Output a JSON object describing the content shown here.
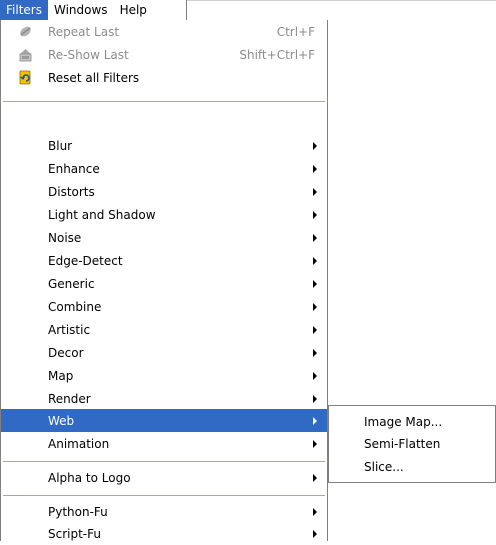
{
  "menubar": [
    {
      "label": "Filters",
      "active": true
    },
    {
      "label": "Windows",
      "active": false
    },
    {
      "label": "Help",
      "active": false
    }
  ],
  "menu": {
    "items": [
      {
        "label": "Repeat Last",
        "shortcut": "Ctrl+F",
        "disabled": true,
        "icon": "repeat-icon"
      },
      {
        "label": "Re-Show Last",
        "shortcut": "Shift+Ctrl+F",
        "disabled": true,
        "icon": "reshow-icon"
      },
      {
        "label": "Reset all Filters",
        "shortcut": "",
        "disabled": false,
        "icon": "reset-icon"
      },
      {
        "label": "Blur",
        "submenu": true
      },
      {
        "label": "Enhance",
        "submenu": true
      },
      {
        "label": "Distorts",
        "submenu": true
      },
      {
        "label": "Light and Shadow",
        "submenu": true
      },
      {
        "label": "Noise",
        "submenu": true
      },
      {
        "label": "Edge-Detect",
        "submenu": true
      },
      {
        "label": "Generic",
        "submenu": true
      },
      {
        "label": "Combine",
        "submenu": true
      },
      {
        "label": "Artistic",
        "submenu": true
      },
      {
        "label": "Decor",
        "submenu": true
      },
      {
        "label": "Map",
        "submenu": true
      },
      {
        "label": "Render",
        "submenu": true
      },
      {
        "label": "Web",
        "submenu": true,
        "selected": true
      },
      {
        "label": "Animation",
        "submenu": true
      },
      {
        "label": "Alpha to Logo",
        "submenu": true
      },
      {
        "label": "Python-Fu",
        "submenu": true
      },
      {
        "label": "Script-Fu",
        "submenu": true
      }
    ]
  },
  "web_submenu": {
    "items": [
      "Image Map...",
      "Semi-Flatten",
      "Slice..."
    ]
  },
  "colors": {
    "highlight": "#316ac5",
    "disabled_text": "#8c8c8c"
  }
}
